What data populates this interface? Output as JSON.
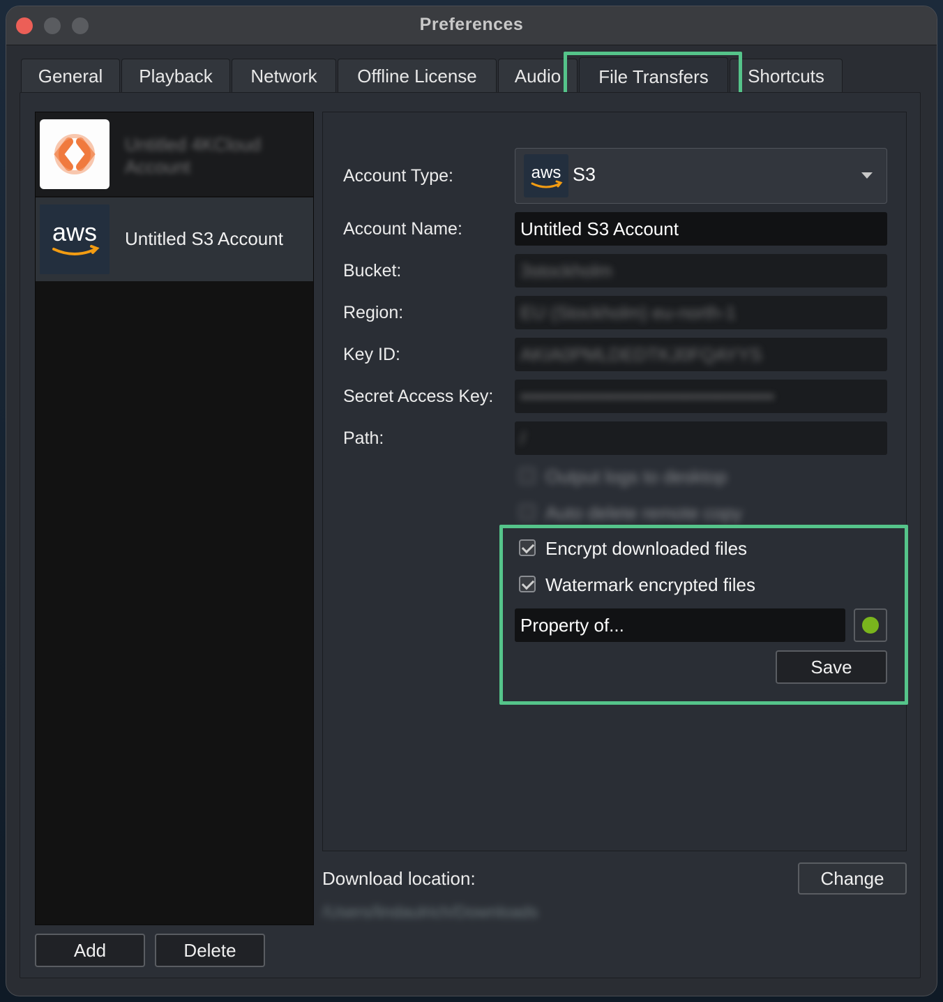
{
  "window": {
    "title": "Preferences"
  },
  "tabs": [
    {
      "label": "General"
    },
    {
      "label": "Playback"
    },
    {
      "label": "Network"
    },
    {
      "label": "Offline License"
    },
    {
      "label": "Audio"
    },
    {
      "label": "File Transfers",
      "active": true
    },
    {
      "label": "Shortcuts"
    }
  ],
  "accounts": [
    {
      "label": "Untitled 4KCloud Account",
      "icon": "cloud-logo-icon",
      "blurred": true
    },
    {
      "label": "Untitled S3 Account",
      "icon": "aws-logo-icon",
      "selected": true
    }
  ],
  "form": {
    "account_type_label": "Account Type:",
    "account_type_value": "S3",
    "account_type_logo_text": "aws",
    "account_name_label": "Account Name:",
    "account_name_value": "Untitled S3 Account",
    "bucket_label": "Bucket:",
    "bucket_value": "3stockholm",
    "region_label": "Region:",
    "region_value": "EU (Stockholm) eu-north-1",
    "key_id_label": "Key ID:",
    "key_id_value": "AKIA0PMLDEDTKJ0FQAYYS",
    "secret_label": "Secret Access Key:",
    "secret_value": "••••••••••••••••••••••••••••••••••••••••",
    "path_label": "Path:",
    "path_value": "/",
    "output_logs_label": "Output logs to desktop",
    "auto_delete_label": "Auto delete remote copy",
    "encrypt_label": "Encrypt downloaded files",
    "watermark_label": "Watermark encrypted files",
    "watermark_text": "Property of...",
    "watermark_color": "#7ab51d",
    "save_label": "Save"
  },
  "download": {
    "label": "Download location:",
    "path": "/Users/lindaulrich/Downloads",
    "change_label": "Change"
  },
  "footer": {
    "add_label": "Add",
    "delete_label": "Delete"
  },
  "colors": {
    "highlight": "#55c48a",
    "aws_orange": "#f39c12",
    "close": "#ec5f57"
  }
}
